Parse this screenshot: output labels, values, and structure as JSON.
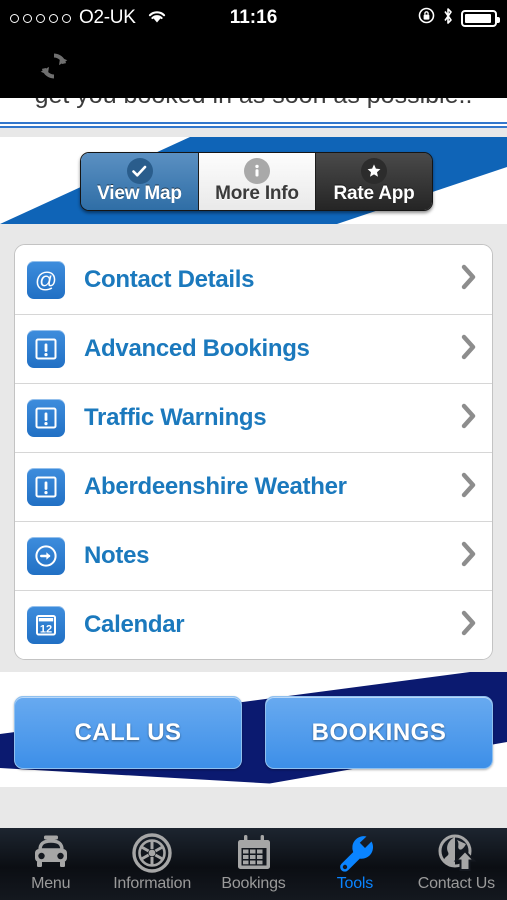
{
  "status_bar": {
    "signal_dots": 5,
    "carrier": "O2-UK",
    "wifi_icon": "wifi-icon",
    "time": "11:16",
    "lock_icon": "rotation-lock-icon",
    "bluetooth_icon": "bluetooth-icon",
    "battery_icon": "battery-icon"
  },
  "nav": {
    "refresh_icon": "refresh-icon"
  },
  "webview": {
    "clipped_text": "get you booked in as soon as possible.."
  },
  "segmented_control": {
    "items": [
      {
        "label": "View Map",
        "icon": "check-circle-icon",
        "state": "selected"
      },
      {
        "label": "More Info",
        "icon": "info-circle-icon",
        "state": "normal"
      },
      {
        "label": "Rate App",
        "icon": "star-circle-icon",
        "state": "dark"
      }
    ]
  },
  "list": {
    "rows": [
      {
        "label": "Contact Details",
        "icon": "at-sign-icon",
        "accessory": "chevron-right-icon"
      },
      {
        "label": "Advanced Bookings",
        "icon": "exclamation-icon",
        "accessory": "chevron-right-icon"
      },
      {
        "label": "Traffic Warnings",
        "icon": "exclamation-icon",
        "accessory": "chevron-right-icon"
      },
      {
        "label": "Aberdeenshire Weather",
        "icon": "exclamation-icon",
        "accessory": "chevron-right-icon"
      },
      {
        "label": "Notes",
        "icon": "arrow-circle-icon",
        "accessory": "chevron-right-icon"
      },
      {
        "label": "Calendar",
        "icon": "calendar-icon",
        "accessory": "chevron-right-icon",
        "icon_text": "12"
      }
    ]
  },
  "actions": {
    "call_label": "CALL US",
    "bookings_label": "BOOKINGS"
  },
  "tabbar": {
    "tabs": [
      {
        "label": "Menu",
        "icon": "taxi-icon",
        "active": false
      },
      {
        "label": "Information",
        "icon": "wheel-icon",
        "active": false
      },
      {
        "label": "Bookings",
        "icon": "calendar-icon",
        "active": false
      },
      {
        "label": "Tools",
        "icon": "wrench-icon",
        "active": true
      },
      {
        "label": "Contact Us",
        "icon": "globe-arrow-icon",
        "active": false
      }
    ]
  },
  "colors": {
    "banner_blue": "#0f64b7",
    "link_blue": "#1b79bd",
    "icon_blue": "#2170c4",
    "navy": "#0b1a70",
    "active_tab": "#0a84ff"
  }
}
